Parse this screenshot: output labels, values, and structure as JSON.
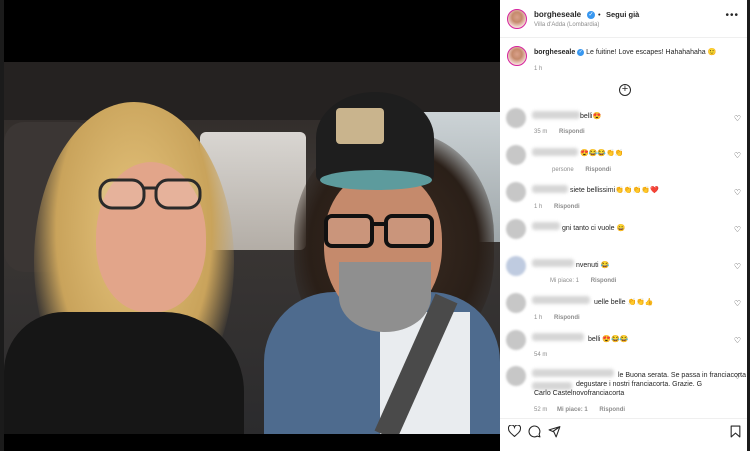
{
  "header": {
    "username": "borgheseale",
    "verified_icon": "verified-badge-icon",
    "follow_separator": "•",
    "follow_label": "Segui già",
    "location": "Villa d'Adda (Lombardia)",
    "more_icon": "more-options-icon"
  },
  "caption": {
    "username": "borgheseale",
    "text": "Le fuitine! Love escapes! Hahahahaha 🙂",
    "time": "1 h"
  },
  "load_more_icon": "plus-circle-icon",
  "comments": [
    {
      "text": "belli😍",
      "time": "35 m",
      "likes": "",
      "reply": "Rispondi"
    },
    {
      "text": "😍😂😂👏👏",
      "time": "",
      "likes": "persone",
      "reply": "Rispondi"
    },
    {
      "text": "siete bellissimi👏👏👏👏❤️",
      "time": "1 h",
      "likes": "",
      "reply": "Rispondi"
    },
    {
      "text": "gni tanto ci vuole 😄",
      "time": "",
      "likes": "",
      "reply": ""
    },
    {
      "text": "nvenuti 😂",
      "time": "",
      "likes": "Mi piace: 1",
      "reply": "Rispondi"
    },
    {
      "text": "uelle belle 👏👏👍",
      "time": "1 h",
      "likes": "",
      "reply": "Rispondi"
    },
    {
      "text": "belli 😍😂😂",
      "time": "54 m",
      "likes": "",
      "reply": ""
    },
    {
      "text": "le Buona serata. Se passa in franciacorta",
      "text2": "degustare i nostri franciacorta. Grazie. G",
      "text3": "Carlo Castelnovofranciacorta",
      "time": "52 m",
      "likes": "Mi piace: 1",
      "reply": "Rispondi"
    }
  ],
  "actions": {
    "like": "heart-icon",
    "comment": "comment-icon",
    "share": "share-icon",
    "save": "bookmark-icon"
  }
}
